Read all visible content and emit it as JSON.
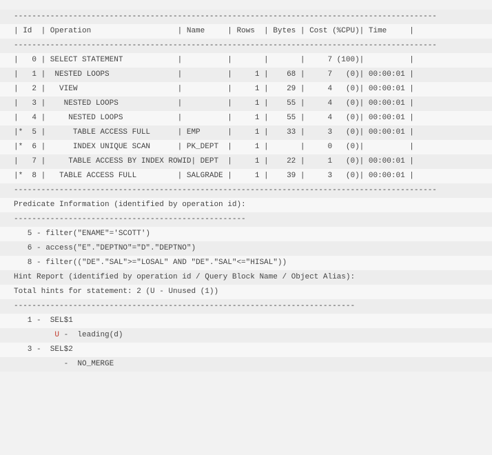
{
  "divider": "---------------------------------------------------------------------------------------------",
  "header": "| Id  | Operation                   | Name     | Rows  | Bytes | Cost (%CPU)| Time     |",
  "plan_rows": [
    "|   0 | SELECT STATEMENT            |          |       |       |     7 (100)|          |",
    "|   1 |  NESTED LOOPS               |          |     1 |    68 |     7   (0)| 00:00:01 |",
    "|   2 |   VIEW                      |          |     1 |    29 |     4   (0)| 00:00:01 |",
    "|   3 |    NESTED LOOPS             |          |     1 |    55 |     4   (0)| 00:00:01 |",
    "|   4 |     NESTED LOOPS            |          |     1 |    55 |     4   (0)| 00:00:01 |",
    "|*  5 |      TABLE ACCESS FULL      | EMP      |     1 |    33 |     3   (0)| 00:00:01 |",
    "|*  6 |      INDEX UNIQUE SCAN      | PK_DEPT  |     1 |       |     0   (0)|          |",
    "|   7 |     TABLE ACCESS BY INDEX ROWID| DEPT  |     1 |    22 |     1   (0)| 00:00:01 |",
    "|*  8 |   TABLE ACCESS FULL         | SALGRADE |     1 |    39 |     3   (0)| 00:00:01 |"
  ],
  "pred": {
    "title": "Predicate Information (identified by operation id):",
    "divider": "---------------------------------------------------",
    "items": [
      "   5 - filter(\"ENAME\"='SCOTT')",
      "   6 - access(\"E\".\"DEPTNO\"=\"D\".\"DEPTNO\")",
      "   8 - filter((\"DE\".\"SAL\">=\"LOSAL\" AND \"DE\".\"SAL\"<=\"HISAL\"))"
    ]
  },
  "hints": {
    "title": "Hint Report (identified by operation id / Query Block Name / Object Alias):",
    "summary": "Total hints for statement: 2 (U - Unused (1))",
    "divider": "---------------------------------------------------------------------------",
    "block1_id": "   1 -  SEL$1",
    "block1_hint_pre": "         ",
    "block1_hint_u": "U",
    "block1_hint_post": " -  leading(d)",
    "block3_id": "   3 -  SEL$2",
    "block3_hint": "           -  NO_MERGE"
  },
  "chart_data": {
    "type": "table",
    "title": "Execution Plan",
    "columns": [
      "Id",
      "Operation",
      "Name",
      "Rows",
      "Bytes",
      "Cost (%CPU)",
      "Time"
    ],
    "rows": [
      {
        "Id": 0,
        "Operation": "SELECT STATEMENT",
        "Name": "",
        "Rows": null,
        "Bytes": null,
        "Cost": "7 (100)",
        "Time": ""
      },
      {
        "Id": 1,
        "Operation": " NESTED LOOPS",
        "Name": "",
        "Rows": 1,
        "Bytes": 68,
        "Cost": "7   (0)",
        "Time": "00:00:01"
      },
      {
        "Id": 2,
        "Operation": "  VIEW",
        "Name": "",
        "Rows": 1,
        "Bytes": 29,
        "Cost": "4   (0)",
        "Time": "00:00:01"
      },
      {
        "Id": 3,
        "Operation": "   NESTED LOOPS",
        "Name": "",
        "Rows": 1,
        "Bytes": 55,
        "Cost": "4   (0)",
        "Time": "00:00:01"
      },
      {
        "Id": 4,
        "Operation": "    NESTED LOOPS",
        "Name": "",
        "Rows": 1,
        "Bytes": 55,
        "Cost": "4   (0)",
        "Time": "00:00:01"
      },
      {
        "Id": 5,
        "Operation": "     TABLE ACCESS FULL",
        "Name": "EMP",
        "Rows": 1,
        "Bytes": 33,
        "Cost": "3   (0)",
        "Time": "00:00:01",
        "star": true
      },
      {
        "Id": 6,
        "Operation": "     INDEX UNIQUE SCAN",
        "Name": "PK_DEPT",
        "Rows": 1,
        "Bytes": null,
        "Cost": "0   (0)",
        "Time": "",
        "star": true
      },
      {
        "Id": 7,
        "Operation": "    TABLE ACCESS BY INDEX ROWID",
        "Name": "DEPT",
        "Rows": 1,
        "Bytes": 22,
        "Cost": "1   (0)",
        "Time": "00:00:01"
      },
      {
        "Id": 8,
        "Operation": "  TABLE ACCESS FULL",
        "Name": "SALGRADE",
        "Rows": 1,
        "Bytes": 39,
        "Cost": "3   (0)",
        "Time": "00:00:01",
        "star": true
      }
    ],
    "predicates": {
      "5": "filter(\"ENAME\"='SCOTT')",
      "6": "access(\"E\".\"DEPTNO\"=\"D\".\"DEPTNO\")",
      "8": "filter((\"DE\".\"SAL\">=\"LOSAL\" AND \"DE\".\"SAL\"<=\"HISAL\"))"
    },
    "hints": {
      "total": 2,
      "unused": 1,
      "entries": [
        {
          "op_id": 1,
          "query_block": "SEL$1",
          "flag": "U",
          "hint": "leading(d)"
        },
        {
          "op_id": 3,
          "query_block": "SEL$2",
          "flag": "",
          "hint": "NO_MERGE"
        }
      ]
    }
  }
}
